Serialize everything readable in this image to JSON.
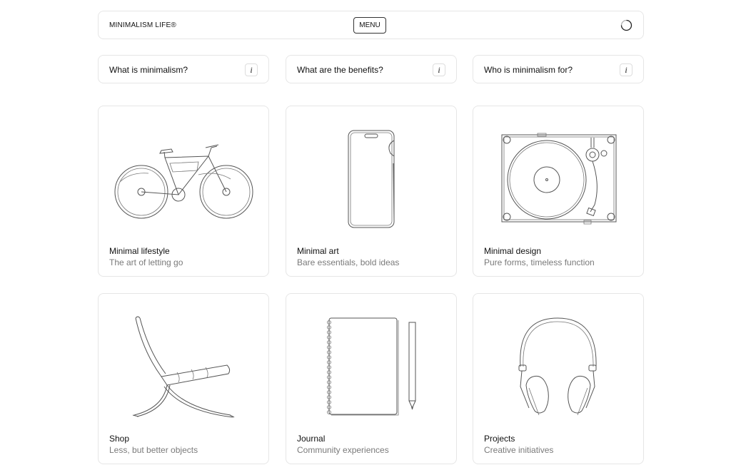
{
  "header": {
    "brand": "MINIMALISM LIFE®",
    "menu_label": "MENU",
    "loader_icon": "loading-spinner-icon"
  },
  "faq": [
    {
      "question": "What is minimalism?",
      "icon": "info-icon",
      "icon_glyph": "i"
    },
    {
      "question": "What are the benefits?",
      "icon": "info-icon",
      "icon_glyph": "i"
    },
    {
      "question": "Who is minimalism for?",
      "icon": "info-icon",
      "icon_glyph": "i"
    }
  ],
  "cards": [
    {
      "title": "Minimal lifestyle",
      "subtitle": "The art of letting go",
      "illustration": "bicycle"
    },
    {
      "title": "Minimal art",
      "subtitle": "Bare essentials, bold ideas",
      "illustration": "smartphone"
    },
    {
      "title": "Minimal design",
      "subtitle": "Pure forms, timeless function",
      "illustration": "turntable"
    },
    {
      "title": "Shop",
      "subtitle": "Less, but better objects",
      "illustration": "lounge-chair"
    },
    {
      "title": "Journal",
      "subtitle": "Community experiences",
      "illustration": "notebook-and-pencil"
    },
    {
      "title": "Projects",
      "subtitle": "Creative initiatives",
      "illustration": "headphones"
    }
  ],
  "colors": {
    "border": "#e6e6e6",
    "text": "#111111",
    "muted": "#7a7a7a",
    "line_art": "#555555"
  }
}
